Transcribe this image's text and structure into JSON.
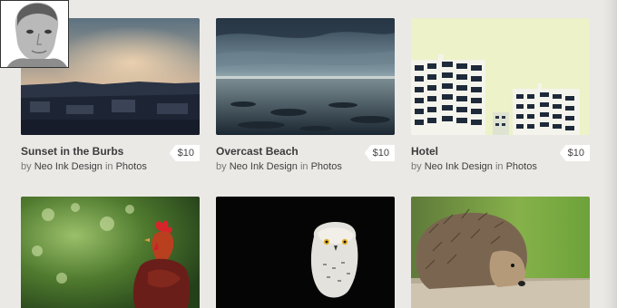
{
  "products": [
    {
      "title": "Sunset in the Burbs",
      "price": "$10",
      "by": "by",
      "author": "Neo Ink Design",
      "in": "in",
      "category": "Photos",
      "image": "sunset-suburbs"
    },
    {
      "title": "Overcast Beach",
      "price": "$10",
      "by": "by",
      "author": "Neo Ink Design",
      "in": "in",
      "category": "Photos",
      "image": "overcast-beach"
    },
    {
      "title": "Hotel",
      "price": "$10",
      "by": "by",
      "author": "Neo Ink Design",
      "in": "in",
      "category": "Photos",
      "image": "hotel-buildings"
    },
    {
      "image": "rooster"
    },
    {
      "image": "snowy-owl"
    },
    {
      "image": "hedgehog"
    }
  ],
  "avatar": {
    "image": "person-portrait"
  }
}
